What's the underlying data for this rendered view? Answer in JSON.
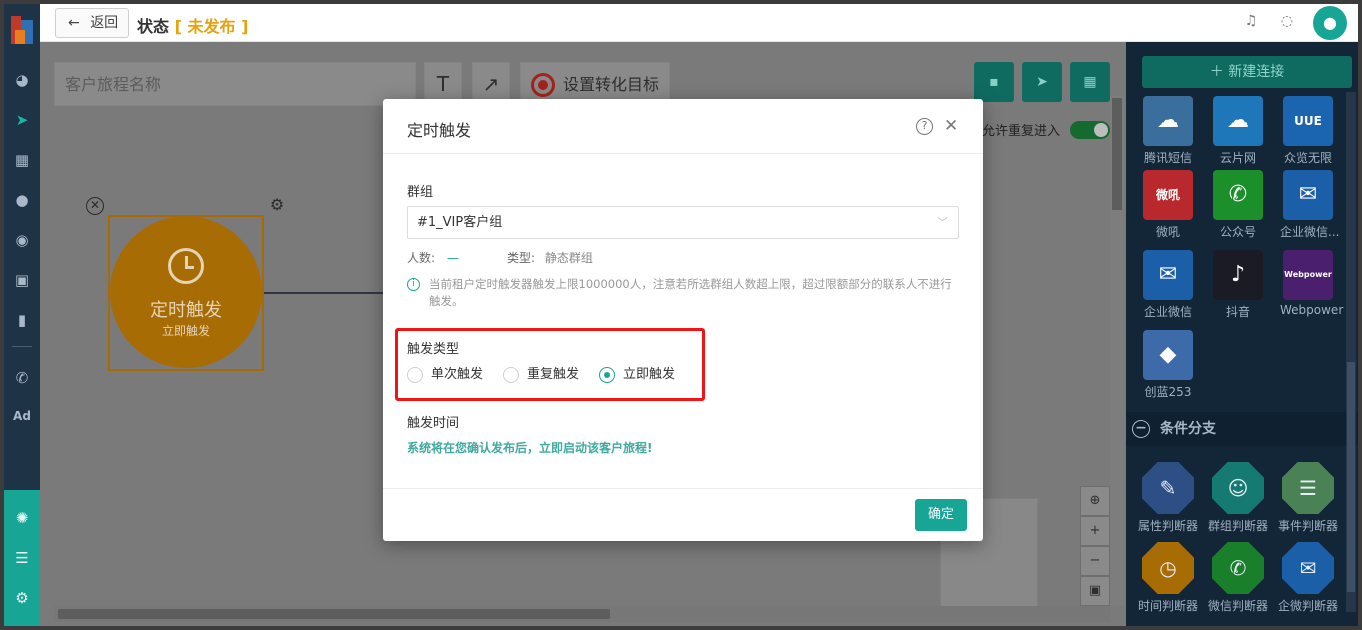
{
  "topbar": {
    "back_label": "返回",
    "title_prefix": "状态",
    "status": "未发布"
  },
  "canvas": {
    "name_placeholder": "客户旅程名称",
    "goal_label": "设置转化目标",
    "repeat_entry_label": "允许重复进入",
    "repeat_entry_enabled": true,
    "node": {
      "title": "定时触发",
      "subtitle": "立即触发"
    }
  },
  "rpanel": {
    "new_connection_label": "新建连接",
    "channels": [
      {
        "label": "腾讯短信",
        "color": "#3a6f9d",
        "icon": "cloud-icon"
      },
      {
        "label": "云片网",
        "color": "#1d77b8",
        "icon": "cloud-icon"
      },
      {
        "label": "众览无限",
        "color": "#1b65b0",
        "icon": "logo-icon",
        "logo_text": "UUE"
      },
      {
        "label": "微吼",
        "color": "#b8282c",
        "icon": "logo-icon",
        "logo_text": "微吼"
      },
      {
        "label": "公众号",
        "color": "#1a8f2a",
        "icon": "wechat-icon"
      },
      {
        "label": "企业微信...",
        "color": "#1b5fa8",
        "icon": "chat-icon"
      },
      {
        "label": "企业微信",
        "color": "#1b5fa8",
        "icon": "chat-icon"
      },
      {
        "label": "抖音",
        "color": "#1b1b25",
        "icon": "tiktok-icon"
      },
      {
        "label": "Webpower",
        "color": "#4a1f6e",
        "icon": "logo-icon",
        "logo_text": "Webpower"
      },
      {
        "label": "创蓝253",
        "color": "#3d6aa8",
        "icon": "cube-icon"
      }
    ],
    "branch_section_label": "条件分支",
    "branches": [
      {
        "label": "属性判断器",
        "color": "#2e4f86",
        "glyph": "✎"
      },
      {
        "label": "群组判断器",
        "color": "#157a72",
        "glyph": "☺"
      },
      {
        "label": "事件判断器",
        "color": "#4a8256",
        "glyph": "☰"
      },
      {
        "label": "时间判断器",
        "color": "#a86c05",
        "glyph": "◷"
      },
      {
        "label": "微信判断器",
        "color": "#1a7f2a",
        "glyph": "✆"
      },
      {
        "label": "企微判断器",
        "color": "#1b5fa8",
        "glyph": "✉"
      }
    ]
  },
  "modal": {
    "title": "定时触发",
    "group_label": "群组",
    "group_value": "#1_VIP客户组",
    "count_label": "人数:",
    "count_value": "—",
    "type_label": "类型:",
    "type_value": "静态群组",
    "info_text": "当前租户定时触发器触发上限1000000人，注意若所选群组人数超上限，超过限额部分的联系人不进行触发。",
    "trigger_type_label": "触发类型",
    "trigger_options": [
      {
        "label": "单次触发",
        "selected": false
      },
      {
        "label": "重复触发",
        "selected": false
      },
      {
        "label": "立即触发",
        "selected": true
      }
    ],
    "trigger_time_label": "触发时间",
    "trigger_time_note": "系统将在您确认发布后，立即启动该客户旅程!",
    "confirm_label": "确定"
  }
}
